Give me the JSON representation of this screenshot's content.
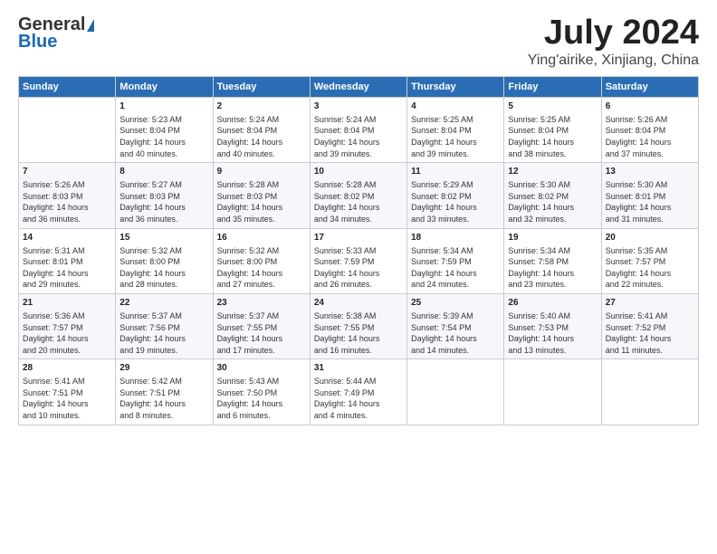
{
  "header": {
    "logo_line1": "General",
    "logo_line2": "Blue",
    "month": "July 2024",
    "location": "Ying'airike, Xinjiang, China"
  },
  "days_header": [
    "Sunday",
    "Monday",
    "Tuesday",
    "Wednesday",
    "Thursday",
    "Friday",
    "Saturday"
  ],
  "weeks": [
    [
      {
        "num": "",
        "lines": []
      },
      {
        "num": "1",
        "lines": [
          "Sunrise: 5:23 AM",
          "Sunset: 8:04 PM",
          "Daylight: 14 hours",
          "and 40 minutes."
        ]
      },
      {
        "num": "2",
        "lines": [
          "Sunrise: 5:24 AM",
          "Sunset: 8:04 PM",
          "Daylight: 14 hours",
          "and 40 minutes."
        ]
      },
      {
        "num": "3",
        "lines": [
          "Sunrise: 5:24 AM",
          "Sunset: 8:04 PM",
          "Daylight: 14 hours",
          "and 39 minutes."
        ]
      },
      {
        "num": "4",
        "lines": [
          "Sunrise: 5:25 AM",
          "Sunset: 8:04 PM",
          "Daylight: 14 hours",
          "and 39 minutes."
        ]
      },
      {
        "num": "5",
        "lines": [
          "Sunrise: 5:25 AM",
          "Sunset: 8:04 PM",
          "Daylight: 14 hours",
          "and 38 minutes."
        ]
      },
      {
        "num": "6",
        "lines": [
          "Sunrise: 5:26 AM",
          "Sunset: 8:04 PM",
          "Daylight: 14 hours",
          "and 37 minutes."
        ]
      }
    ],
    [
      {
        "num": "7",
        "lines": [
          "Sunrise: 5:26 AM",
          "Sunset: 8:03 PM",
          "Daylight: 14 hours",
          "and 36 minutes."
        ]
      },
      {
        "num": "8",
        "lines": [
          "Sunrise: 5:27 AM",
          "Sunset: 8:03 PM",
          "Daylight: 14 hours",
          "and 36 minutes."
        ]
      },
      {
        "num": "9",
        "lines": [
          "Sunrise: 5:28 AM",
          "Sunset: 8:03 PM",
          "Daylight: 14 hours",
          "and 35 minutes."
        ]
      },
      {
        "num": "10",
        "lines": [
          "Sunrise: 5:28 AM",
          "Sunset: 8:02 PM",
          "Daylight: 14 hours",
          "and 34 minutes."
        ]
      },
      {
        "num": "11",
        "lines": [
          "Sunrise: 5:29 AM",
          "Sunset: 8:02 PM",
          "Daylight: 14 hours",
          "and 33 minutes."
        ]
      },
      {
        "num": "12",
        "lines": [
          "Sunrise: 5:30 AM",
          "Sunset: 8:02 PM",
          "Daylight: 14 hours",
          "and 32 minutes."
        ]
      },
      {
        "num": "13",
        "lines": [
          "Sunrise: 5:30 AM",
          "Sunset: 8:01 PM",
          "Daylight: 14 hours",
          "and 31 minutes."
        ]
      }
    ],
    [
      {
        "num": "14",
        "lines": [
          "Sunrise: 5:31 AM",
          "Sunset: 8:01 PM",
          "Daylight: 14 hours",
          "and 29 minutes."
        ]
      },
      {
        "num": "15",
        "lines": [
          "Sunrise: 5:32 AM",
          "Sunset: 8:00 PM",
          "Daylight: 14 hours",
          "and 28 minutes."
        ]
      },
      {
        "num": "16",
        "lines": [
          "Sunrise: 5:32 AM",
          "Sunset: 8:00 PM",
          "Daylight: 14 hours",
          "and 27 minutes."
        ]
      },
      {
        "num": "17",
        "lines": [
          "Sunrise: 5:33 AM",
          "Sunset: 7:59 PM",
          "Daylight: 14 hours",
          "and 26 minutes."
        ]
      },
      {
        "num": "18",
        "lines": [
          "Sunrise: 5:34 AM",
          "Sunset: 7:59 PM",
          "Daylight: 14 hours",
          "and 24 minutes."
        ]
      },
      {
        "num": "19",
        "lines": [
          "Sunrise: 5:34 AM",
          "Sunset: 7:58 PM",
          "Daylight: 14 hours",
          "and 23 minutes."
        ]
      },
      {
        "num": "20",
        "lines": [
          "Sunrise: 5:35 AM",
          "Sunset: 7:57 PM",
          "Daylight: 14 hours",
          "and 22 minutes."
        ]
      }
    ],
    [
      {
        "num": "21",
        "lines": [
          "Sunrise: 5:36 AM",
          "Sunset: 7:57 PM",
          "Daylight: 14 hours",
          "and 20 minutes."
        ]
      },
      {
        "num": "22",
        "lines": [
          "Sunrise: 5:37 AM",
          "Sunset: 7:56 PM",
          "Daylight: 14 hours",
          "and 19 minutes."
        ]
      },
      {
        "num": "23",
        "lines": [
          "Sunrise: 5:37 AM",
          "Sunset: 7:55 PM",
          "Daylight: 14 hours",
          "and 17 minutes."
        ]
      },
      {
        "num": "24",
        "lines": [
          "Sunrise: 5:38 AM",
          "Sunset: 7:55 PM",
          "Daylight: 14 hours",
          "and 16 minutes."
        ]
      },
      {
        "num": "25",
        "lines": [
          "Sunrise: 5:39 AM",
          "Sunset: 7:54 PM",
          "Daylight: 14 hours",
          "and 14 minutes."
        ]
      },
      {
        "num": "26",
        "lines": [
          "Sunrise: 5:40 AM",
          "Sunset: 7:53 PM",
          "Daylight: 14 hours",
          "and 13 minutes."
        ]
      },
      {
        "num": "27",
        "lines": [
          "Sunrise: 5:41 AM",
          "Sunset: 7:52 PM",
          "Daylight: 14 hours",
          "and 11 minutes."
        ]
      }
    ],
    [
      {
        "num": "28",
        "lines": [
          "Sunrise: 5:41 AM",
          "Sunset: 7:51 PM",
          "Daylight: 14 hours",
          "and 10 minutes."
        ]
      },
      {
        "num": "29",
        "lines": [
          "Sunrise: 5:42 AM",
          "Sunset: 7:51 PM",
          "Daylight: 14 hours",
          "and 8 minutes."
        ]
      },
      {
        "num": "30",
        "lines": [
          "Sunrise: 5:43 AM",
          "Sunset: 7:50 PM",
          "Daylight: 14 hours",
          "and 6 minutes."
        ]
      },
      {
        "num": "31",
        "lines": [
          "Sunrise: 5:44 AM",
          "Sunset: 7:49 PM",
          "Daylight: 14 hours",
          "and 4 minutes."
        ]
      },
      {
        "num": "",
        "lines": []
      },
      {
        "num": "",
        "lines": []
      },
      {
        "num": "",
        "lines": []
      }
    ]
  ]
}
